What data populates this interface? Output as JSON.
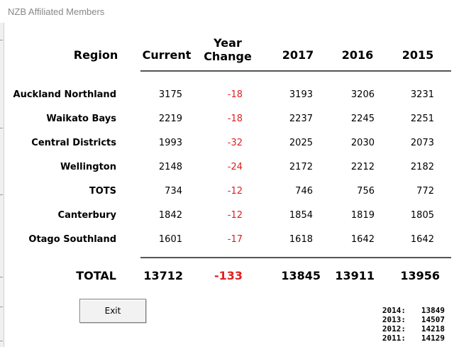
{
  "window": {
    "title": "NZB Affiliated Members"
  },
  "headers": {
    "region": "Region",
    "current": "Current",
    "change_line1": "Year",
    "change_line2": "Change",
    "y2017": "2017",
    "y2016": "2016",
    "y2015": "2015"
  },
  "rows": [
    {
      "region": "Auckland Northland",
      "current": "3175",
      "change": "-18",
      "y2017": "3193",
      "y2016": "3206",
      "y2015": "3231"
    },
    {
      "region": "Waikato Bays",
      "current": "2219",
      "change": "-18",
      "y2017": "2237",
      "y2016": "2245",
      "y2015": "2251"
    },
    {
      "region": "Central Districts",
      "current": "1993",
      "change": "-32",
      "y2017": "2025",
      "y2016": "2030",
      "y2015": "2073"
    },
    {
      "region": "Wellington",
      "current": "2148",
      "change": "-24",
      "y2017": "2172",
      "y2016": "2212",
      "y2015": "2182"
    },
    {
      "region": "TOTS",
      "current": "734",
      "change": "-12",
      "y2017": "746",
      "y2016": "756",
      "y2015": "772"
    },
    {
      "region": "Canterbury",
      "current": "1842",
      "change": "-12",
      "y2017": "1854",
      "y2016": "1819",
      "y2015": "1805"
    },
    {
      "region": "Otago Southland",
      "current": "1601",
      "change": "-17",
      "y2017": "1618",
      "y2016": "1642",
      "y2015": "1642"
    }
  ],
  "total": {
    "label": "TOTAL",
    "current": "13712",
    "change": "-133",
    "y2017": "13845",
    "y2016": "13911",
    "y2015": "13956"
  },
  "exit_button": {
    "label": "Exit"
  },
  "history": [
    {
      "year": "2014:",
      "value": "13849"
    },
    {
      "year": "2013:",
      "value": "14507"
    },
    {
      "year": "2012:",
      "value": "14218"
    },
    {
      "year": "2011:",
      "value": "14129"
    }
  ],
  "colors": {
    "negative": "#e02020",
    "rule": "#555555",
    "title": "#888888"
  }
}
